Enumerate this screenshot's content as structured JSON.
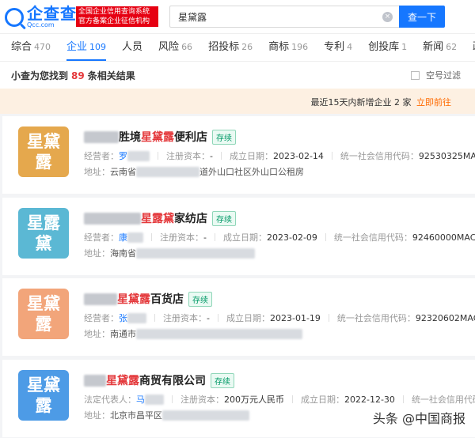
{
  "header": {
    "logo_cn": "企查查",
    "logo_en": "Qcc.com",
    "badge_line1": "全国企业信用查询系统",
    "badge_line2": "官方备案企业征信机构",
    "search_value": "星黛露",
    "clear_symbol": "×",
    "search_button": "查一下"
  },
  "tabs": [
    {
      "label": "综合",
      "count": "470"
    },
    {
      "label": "企业",
      "count": "109",
      "active": true
    },
    {
      "label": "人员",
      "count": ""
    },
    {
      "label": "风险",
      "count": "66"
    },
    {
      "label": "招投标",
      "count": "26"
    },
    {
      "label": "商标",
      "count": "196"
    },
    {
      "label": "专利",
      "count": "4"
    },
    {
      "label": "创投库",
      "count": "1"
    },
    {
      "label": "新闻",
      "count": "62"
    },
    {
      "label": "政策",
      "count": ""
    }
  ],
  "summary": {
    "prefix": "小查为您找到",
    "count": "89",
    "suffix": "条相关结果",
    "filter_label": "空号过滤"
  },
  "notice": {
    "text_prefix": "最近15天内新增企业",
    "count": "2",
    "text_suffix": "家",
    "link": "立即前往"
  },
  "results": [
    {
      "avatar_text": [
        "星黛",
        "露"
      ],
      "avatar_color": "#e5a84d",
      "name_prefix": "胜境",
      "name_hl": "星黛露",
      "name_suffix": "便利店",
      "status": "存续",
      "person_label": "经营者：",
      "person": "罗",
      "capital_label": "注册资本：",
      "capital": "-",
      "date_label": "成立日期：",
      "date": "2023-02-14",
      "credit_label": "统一社会信用代码：",
      "credit": "92530325MAC",
      "addr_label": "地址：",
      "addr_prefix": "云南省",
      "addr_suffix": "道外山口社区外山口公租房"
    },
    {
      "avatar_text": [
        "星露",
        "黛"
      ],
      "avatar_color": "#5bb8d4",
      "name_prefix": "",
      "name_hl": "星露黛",
      "name_suffix": "家纺店",
      "status": "存续",
      "person_label": "经营者：",
      "person": "康",
      "capital_label": "注册资本：",
      "capital": "-",
      "date_label": "成立日期：",
      "date": "2023-02-09",
      "credit_label": "统一社会信用代码：",
      "credit": "92460000MAC",
      "addr_label": "地址：",
      "addr_prefix": "海南省",
      "addr_suffix": ""
    },
    {
      "avatar_text": [
        "星黛",
        "露"
      ],
      "avatar_color": "#f2a57a",
      "name_prefix": "",
      "name_hl": "星黛露",
      "name_suffix": "百货店",
      "status": "存续",
      "person_label": "经营者：",
      "person": "张",
      "capital_label": "注册资本：",
      "capital": "-",
      "date_label": "成立日期：",
      "date": "2023-01-19",
      "credit_label": "统一社会信用代码：",
      "credit": "92320602MAC",
      "addr_label": "地址：",
      "addr_prefix": "南通市",
      "addr_suffix": ""
    },
    {
      "avatar_text": [
        "星黛",
        "露"
      ],
      "avatar_color": "#4d9be6",
      "name_prefix": "",
      "name_hl": "星黛露",
      "name_suffix": "商贸有限公司",
      "status": "存续",
      "person_label": "法定代表人：",
      "person": "马",
      "capital_label": "注册资本：",
      "capital": "200万元人民币",
      "date_label": "成立日期：",
      "date": "2022-12-30",
      "credit_label": "统一社会信用代码：",
      "credit": "",
      "addr_label": "地址：",
      "addr_prefix": "北京市昌平区",
      "addr_suffix": ""
    }
  ],
  "watermark": "头条 @中国商报"
}
